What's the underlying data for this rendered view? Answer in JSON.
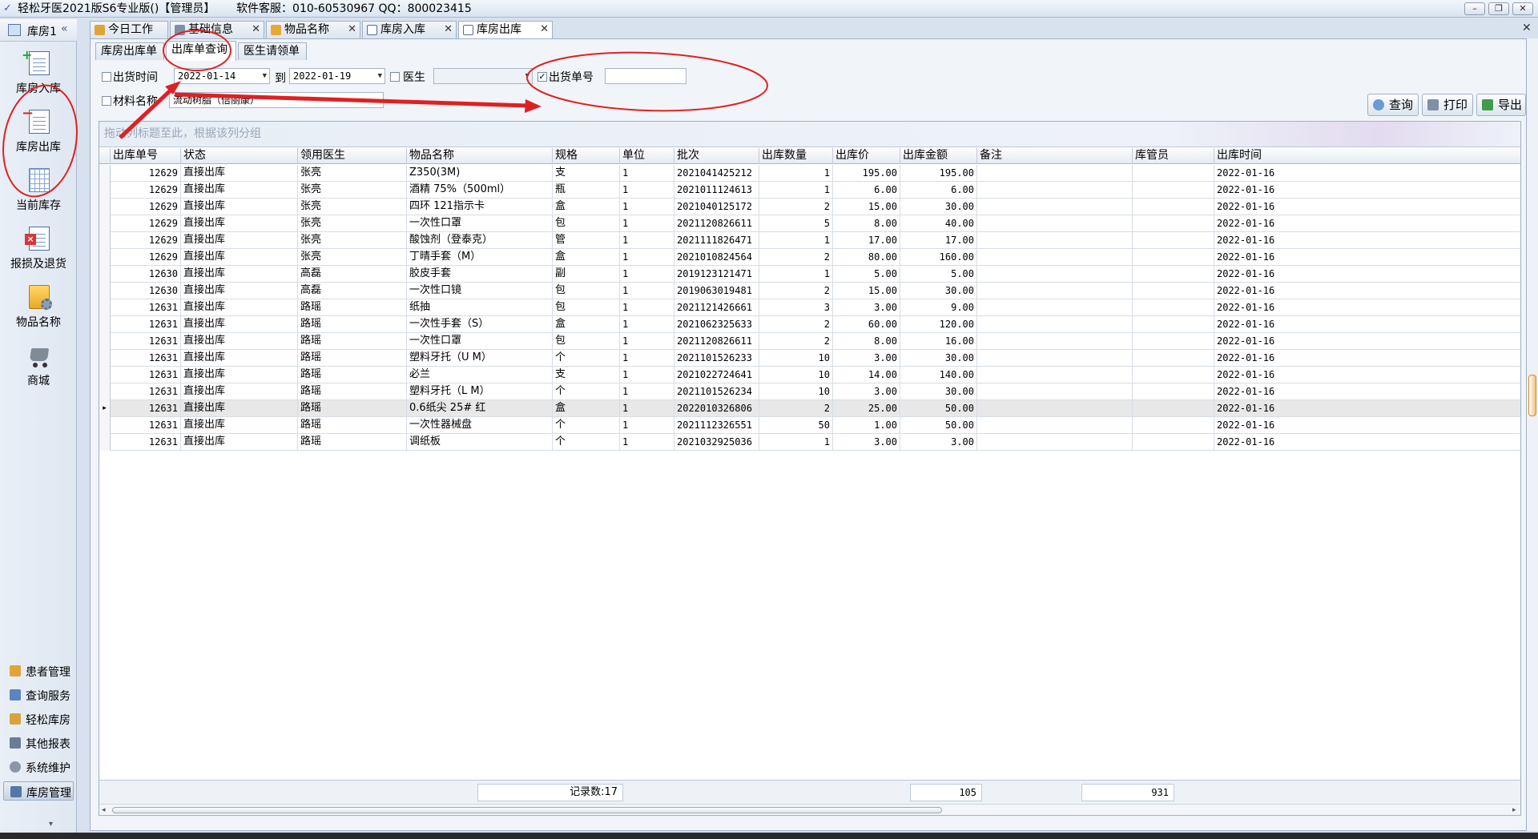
{
  "window": {
    "title": "轻松牙医2021版S6专业版()【管理员】      软件客服：010-60530967 QQ：800023415",
    "controls": {
      "minimize": "–",
      "restore": "❐",
      "close": "✕"
    }
  },
  "sidebar": {
    "header": "库房1",
    "collapse": "«",
    "big_items": [
      {
        "label": "库房入库"
      },
      {
        "label": "库房出库"
      },
      {
        "label": "当前库存"
      },
      {
        "label": "报损及退货"
      },
      {
        "label": "物品名称"
      },
      {
        "label": "商城"
      }
    ],
    "small_items": [
      {
        "label": "患者管理"
      },
      {
        "label": "查询服务"
      },
      {
        "label": "轻松库房"
      },
      {
        "label": "其他报表"
      },
      {
        "label": "系统维护"
      },
      {
        "label": "库房管理"
      }
    ],
    "footer": "▾"
  },
  "doc_tabs": [
    {
      "label": "今日工作"
    },
    {
      "label": "基础信息"
    },
    {
      "label": "物品名称"
    },
    {
      "label": "库房入库"
    },
    {
      "label": "库房出库"
    }
  ],
  "tab_close": "✕",
  "sub_tabs": [
    {
      "label": "库房出库单"
    },
    {
      "label": "出库单查询"
    },
    {
      "label": "医生请领单"
    }
  ],
  "filters": {
    "ship_time_label": "出货时间",
    "date_from": "2022-01-14",
    "to_label": "到",
    "date_to": "2022-01-19",
    "doctor_label": "医生",
    "doctor_value": "",
    "order_no_label": "出货单号",
    "order_no_checked": "✓",
    "order_no_value": "",
    "material_label": "材料名称",
    "material_value": "流动树脂（倍丽康）"
  },
  "buttons": {
    "query": "查询",
    "print": "打印",
    "export": "导出"
  },
  "grid": {
    "group_hint": "拖动列标题至此，根据该列分组",
    "columns": [
      "出库单号",
      "状态",
      "领用医生",
      "物品名称",
      "规格",
      "单位",
      "批次",
      "出库数量",
      "出库价",
      "出库金额",
      "备注",
      "库管员",
      "出库时间"
    ],
    "rows": [
      [
        "12629",
        "直接出库",
        "张亮",
        "Z350(3M)",
        "支",
        "1",
        "2021041425212",
        "1",
        "195.00",
        "195.00",
        "",
        "",
        "2022-01-16"
      ],
      [
        "12629",
        "直接出库",
        "张亮",
        "酒精 75%（500ml）",
        "瓶",
        "1",
        "2021011124613",
        "1",
        "6.00",
        "6.00",
        "",
        "",
        "2022-01-16"
      ],
      [
        "12629",
        "直接出库",
        "张亮",
        "四环 121指示卡",
        "盒",
        "1",
        "2021040125172",
        "2",
        "15.00",
        "30.00",
        "",
        "",
        "2022-01-16"
      ],
      [
        "12629",
        "直接出库",
        "张亮",
        "一次性口罩",
        "包",
        "1",
        "2021120826611",
        "5",
        "8.00",
        "40.00",
        "",
        "",
        "2022-01-16"
      ],
      [
        "12629",
        "直接出库",
        "张亮",
        "酸蚀剂（登泰克）",
        "管",
        "1",
        "2021111826471",
        "1",
        "17.00",
        "17.00",
        "",
        "",
        "2022-01-16"
      ],
      [
        "12629",
        "直接出库",
        "张亮",
        "丁晴手套（M）",
        "盒",
        "1",
        "2021010824564",
        "2",
        "80.00",
        "160.00",
        "",
        "",
        "2022-01-16"
      ],
      [
        "12630",
        "直接出库",
        "高磊",
        "胶皮手套",
        "副",
        "1",
        "2019123121471",
        "1",
        "5.00",
        "5.00",
        "",
        "",
        "2022-01-16"
      ],
      [
        "12630",
        "直接出库",
        "高磊",
        "一次性口镜",
        "包",
        "1",
        "2019063019481",
        "2",
        "15.00",
        "30.00",
        "",
        "",
        "2022-01-16"
      ],
      [
        "12631",
        "直接出库",
        "路瑶",
        "纸抽",
        "包",
        "1",
        "2021121426661",
        "3",
        "3.00",
        "9.00",
        "",
        "",
        "2022-01-16"
      ],
      [
        "12631",
        "直接出库",
        "路瑶",
        "一次性手套（S）",
        "盒",
        "1",
        "2021062325633",
        "2",
        "60.00",
        "120.00",
        "",
        "",
        "2022-01-16"
      ],
      [
        "12631",
        "直接出库",
        "路瑶",
        "一次性口罩",
        "包",
        "1",
        "2021120826611",
        "2",
        "8.00",
        "16.00",
        "",
        "",
        "2022-01-16"
      ],
      [
        "12631",
        "直接出库",
        "路瑶",
        "塑料牙托（U M）",
        "个",
        "1",
        "2021101526233",
        "10",
        "3.00",
        "30.00",
        "",
        "",
        "2022-01-16"
      ],
      [
        "12631",
        "直接出库",
        "路瑶",
        "必兰",
        "支",
        "1",
        "2021022724641",
        "10",
        "14.00",
        "140.00",
        "",
        "",
        "2022-01-16"
      ],
      [
        "12631",
        "直接出库",
        "路瑶",
        "塑料牙托（L M）",
        "个",
        "1",
        "2021101526234",
        "10",
        "3.00",
        "30.00",
        "",
        "",
        "2022-01-16"
      ],
      [
        "12631",
        "直接出库",
        "路瑶",
        "0.6纸尖 25# 红",
        "盒",
        "1",
        "2022010326806",
        "2",
        "25.00",
        "50.00",
        "",
        "",
        "2022-01-16"
      ],
      [
        "12631",
        "直接出库",
        "路瑶",
        "一次性器械盘",
        "个",
        "1",
        "2021112326551",
        "50",
        "1.00",
        "50.00",
        "",
        "",
        "2022-01-16"
      ],
      [
        "12631",
        "直接出库",
        "路瑶",
        "调纸板",
        "个",
        "1",
        "2021032925036",
        "1",
        "3.00",
        "3.00",
        "",
        "",
        "2022-01-16"
      ]
    ],
    "current_row_marker": "▸",
    "footer": {
      "record_count": "记录数:17",
      "qty_total": "105",
      "amount_total": "931"
    },
    "scroll_left": "◂",
    "scroll_right": "▸"
  },
  "colors": {
    "annotation_red": "#e02020",
    "header_bg": "#e5ebf2",
    "border": "#9fb1c8"
  }
}
